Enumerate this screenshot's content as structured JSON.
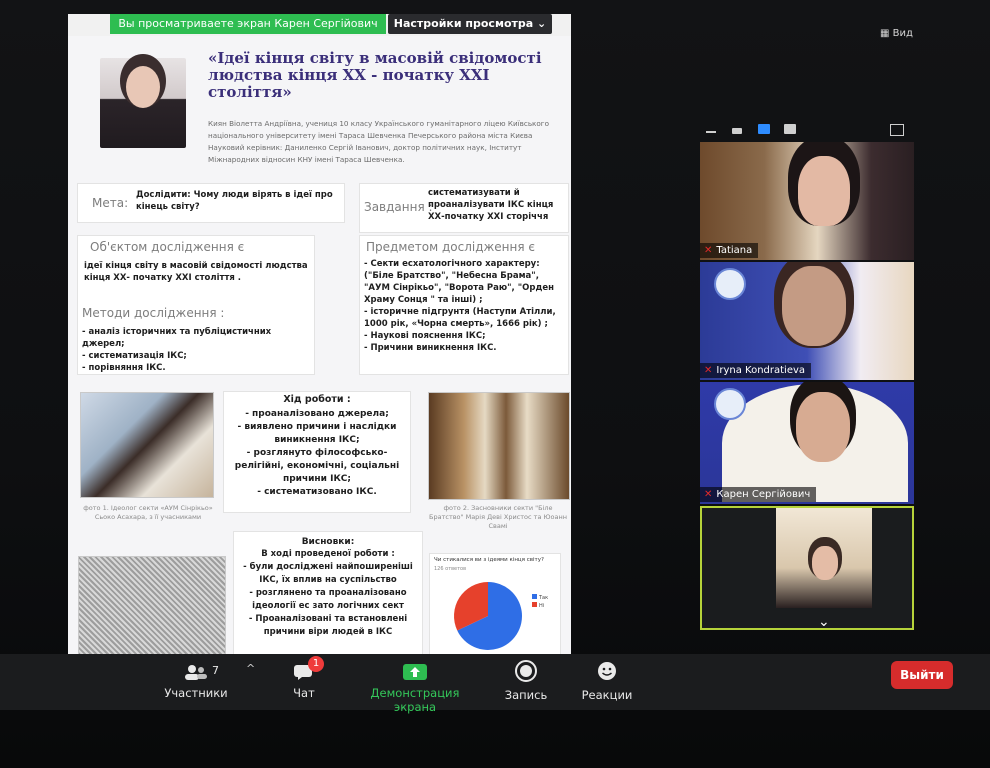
{
  "banner": {
    "text": "Вы просматриваете экран Карен Сергійович",
    "settings_label": "Настройки просмотра"
  },
  "top_right": {
    "view_label": "Вид"
  },
  "poster": {
    "title": "«Ідеї кінця світу в масовій свідомості людства кінця ХХ - початку ХХІ століття»",
    "authors": "Киян Віолетта Андріївна, учениця 10 класу Українського гуманітарного ліцею Київського національного університету імені Тараса Шевченка Печерського района міста Києва Науковий керівник: Даниленко Сергій Іванович, доктор політичних наук, Інститут Міжнародних відносин КНУ імені Тараса Шевченка.",
    "meta_label": "Мета:",
    "meta_text": "Дослідити: Чому люди вірять в ідеї про кінець світу?",
    "zavdannia_label": "Завдання :",
    "zavdannia_text": "систематизувати й проаналізувати ІКС кінця ХХ-початку ХХІ сторіччя",
    "obiekt_label": "Об'єктом дослідження є",
    "obiekt_text": "ідеї кінця світу в масовій свідомості людства кінця ХХ- початку ХХІ століття .",
    "predmet_label": "Предметом дослідження є",
    "predmet_items": [
      "- Секти есхатологічного характеру: (\"Біле Братство\", \"Небесна Брама\",",
      "\"АУМ Сінрікьо\", \"Ворота Раю\", \"Орден Храму Сонця \" та інші) ;",
      "- історичне підгрунтя (Наступи Атілли, 1000 рік, «Чорна смерть», 1666 рік) ;",
      "- Наукові пояснення ІКС;",
      "- Причини виникнення ІКС."
    ],
    "metody_label": "Методи дослідження :",
    "metody_items": [
      "- аналіз історичних та публіцистичних джерел;",
      "- систематизація ІКС;",
      "- порівняння ІКС."
    ],
    "hid_title": "Хід роботи :",
    "hid_items": [
      "- проаналізовано джерела;",
      "- виявлено причини і наслідки виникнення ІКС;",
      "- розглянуто філософсько-релігійні, економічні, соціальні причини ІКС;",
      "- систематизовано ІКС."
    ],
    "caption1": "фото 1. Ідеолог секти «АУМ Сінрікьо» Сьоко Асахара, з її учасниками",
    "caption2": "фото 2. Засновники секти \"Біле Братство\" Марія Деві Христос та Юоанн Свамі",
    "vysnovky_title": "Висновки:",
    "vysnovky_items": [
      "В ході проведеної роботи :",
      "- були досліджені найпоширеніші ІКС, їх вплив на суспільство",
      "- розглянено та проаналізовано ідеології ес зато логічних сект",
      "- Проаналізовані та встановлені причини віри людей в ІКС"
    ],
    "pie_title": "Чи стикалися ви з ідеями кінця світу?",
    "pie_sub": "126 ответов"
  },
  "chart_data": {
    "type": "pie",
    "title": "Чи стикалися ви з ідеями кінця світу?",
    "categories": [
      "Так",
      "Ні"
    ],
    "values": [
      68,
      32
    ],
    "colors": [
      "#2f6ee6",
      "#e6412c"
    ]
  },
  "participants": [
    {
      "name": "Tatiana",
      "muted": true
    },
    {
      "name": "Iryna Kondratieva",
      "muted": true
    },
    {
      "name": "Карен Сергійович",
      "muted": true
    },
    {
      "name": "",
      "muted": false
    }
  ],
  "toolbar": {
    "participants_label": "Участники",
    "participants_count": "7",
    "chat_label": "Чат",
    "chat_badge": "1",
    "share_label": "Демонстрация экрана",
    "record_label": "Запись",
    "reactions_label": "Реакции",
    "leave_label": "Выйти"
  },
  "colors": {
    "accent": "#2ebd51",
    "leave": "#d62c2c",
    "title": "#3b2f7a"
  }
}
